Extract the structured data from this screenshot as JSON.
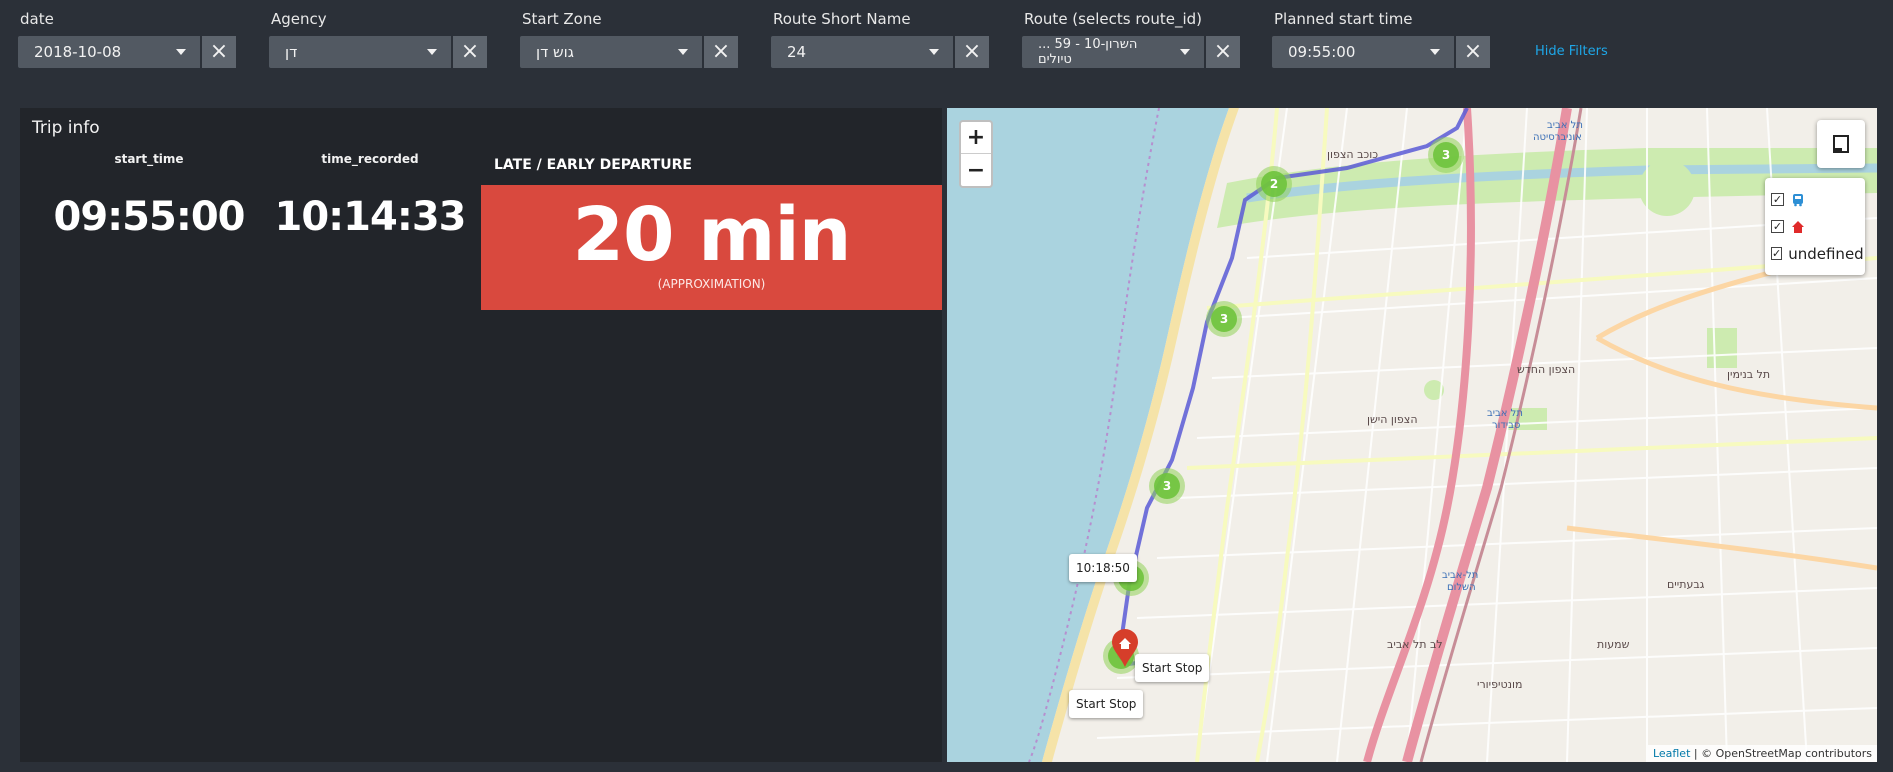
{
  "filters": {
    "date": {
      "label": "date",
      "value": "2018-10-08"
    },
    "agency": {
      "label": "Agency",
      "value": "דן"
    },
    "start_zone": {
      "label": "Start Zone",
      "value": "גוש דן"
    },
    "route_short_name": {
      "label": "Route Short Name",
      "value": "24"
    },
    "route": {
      "label": "Route (selects route_id)",
      "value": "... השרון-10 - 59 טיולים"
    },
    "planned_start": {
      "label": "Planned start time",
      "value": "09:55:00"
    },
    "clear_icon": "close-icon",
    "hide_filters": "Hide Filters"
  },
  "trip": {
    "title": "Trip info",
    "start_time_label": "start_time",
    "start_time": "09:55:00",
    "time_recorded_label": "time_recorded",
    "time_recorded": "10:14:33",
    "late_label": "LATE / EARLY DEPARTURE",
    "late_value": "20 min",
    "late_sub": "(APPROXIMATION)",
    "late_color": "#d9493e"
  },
  "map": {
    "zoom_in": "+",
    "zoom_out": "−",
    "legend": [
      {
        "icon": "bus-icon",
        "checked": true
      },
      {
        "icon": "home-icon",
        "checked": true
      },
      {
        "label": "undefined",
        "checked": true
      }
    ],
    "clusters": [
      "3",
      "3",
      "2",
      "3",
      "3"
    ],
    "tooltips": {
      "time": "10:18:50",
      "start_stop_a": "Start Stop",
      "start_stop_b": "Start Stop"
    },
    "attribution_link": "Leaflet",
    "attribution_text": " | © OpenStreetMap contributors",
    "route_color": "#5a5ad6",
    "cluster_color": "#6ec33c"
  }
}
